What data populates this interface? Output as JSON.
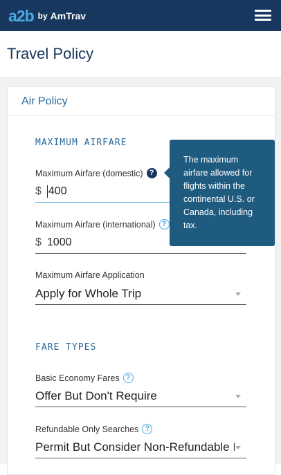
{
  "header": {
    "logo_mark": "a2b",
    "logo_by": "by",
    "logo_brand": "AmTrav",
    "menu_icon": "hamburger-icon"
  },
  "page": {
    "title": "Travel Policy"
  },
  "panel": {
    "title": "Air Policy"
  },
  "sections": {
    "max_airfare": {
      "heading": "MAXIMUM AIRFARE",
      "domestic_label": "Maximum Airfare (domestic)",
      "domestic_currency": "$",
      "domestic_value": "400",
      "international_label": "Maximum Airfare (international)",
      "international_currency": "$",
      "international_value": "1000",
      "application_label": "Maximum Airfare Application",
      "application_value": "Apply for Whole Trip"
    },
    "fare_types": {
      "heading": "FARE TYPES",
      "basic_economy_label": "Basic Economy Fares",
      "basic_economy_value": "Offer But Don't Require",
      "refundable_label": "Refundable Only Searches",
      "refundable_value": "Permit But Consider Non-Refundable I"
    }
  },
  "tooltip": {
    "text": "The maximum airfare allowed for flights within the continental U.S. or Canada, including tax."
  },
  "help_glyph": "?",
  "colors": {
    "topbar": "#17375e",
    "accent": "#4aa9e0",
    "title": "#17375e",
    "tooltip_bg": "#1f5a7f"
  }
}
